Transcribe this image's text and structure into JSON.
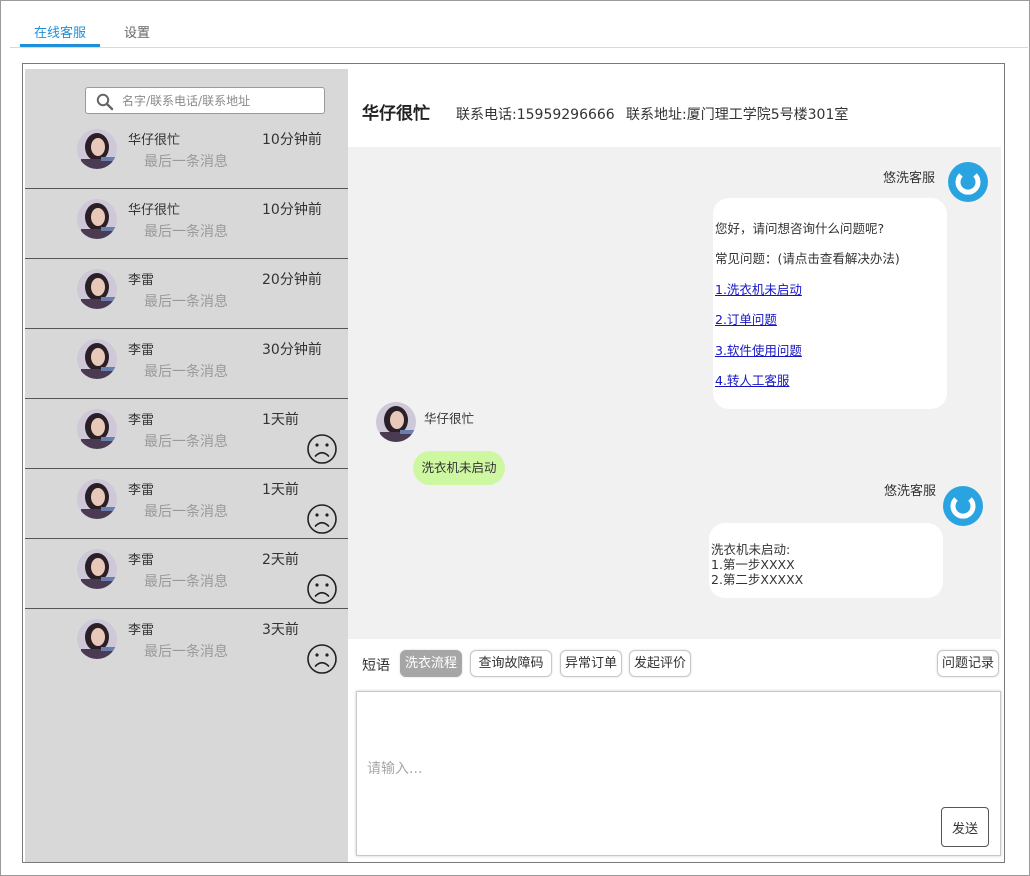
{
  "tabs": [
    {
      "label": "在线客服",
      "active": true
    },
    {
      "label": "设置",
      "active": false
    }
  ],
  "search": {
    "placeholder": "名字/联系电话/联系地址"
  },
  "contacts": [
    {
      "name": "华仔很忙",
      "time": "10分钟前",
      "last_msg": "最后一条消息",
      "sad_icon": false
    },
    {
      "name": "华仔很忙",
      "time": "10分钟前",
      "last_msg": "最后一条消息",
      "sad_icon": false
    },
    {
      "name": "李雷",
      "time": "20分钟前",
      "last_msg": "最后一条消息",
      "sad_icon": false
    },
    {
      "name": "李雷",
      "time": "30分钟前",
      "last_msg": "最后一条消息",
      "sad_icon": false
    },
    {
      "name": "李雷",
      "time": "1天前",
      "last_msg": "最后一条消息",
      "sad_icon": true
    },
    {
      "name": "李雷",
      "time": "1天前",
      "last_msg": "最后一条消息",
      "sad_icon": true
    },
    {
      "name": "李雷",
      "time": "2天前",
      "last_msg": "最后一条消息",
      "sad_icon": true
    },
    {
      "name": "李雷",
      "time": "3天前",
      "last_msg": "最后一条消息",
      "sad_icon": true
    }
  ],
  "header": {
    "name": "华仔很忙",
    "phone": "联系电话:15959296666",
    "address": "联系地址:厦门理工学院5号楼301室"
  },
  "messages": {
    "bot_name": "悠洗客服",
    "greeting": "您好，请问想咨询什么问题呢?",
    "faq_title": "常见问题：(请点击查看解决办法)",
    "faq_links": [
      "1.洗衣机未启动",
      "2.订单问题",
      "3.软件使用问题",
      "4.转人工客服"
    ],
    "user_name": "华仔很忙",
    "user_msg": "洗衣机未启动",
    "bot_name_2": "悠洗客服",
    "reply_lines": [
      "洗衣机未启动:",
      "1.第一步XXXX",
      "2.第二步XXXXX"
    ]
  },
  "toolbar": {
    "label": "短语",
    "chips": [
      "洗衣流程",
      "查询故障码",
      "异常订单",
      "发起评价"
    ],
    "history_label": "问题记录"
  },
  "input": {
    "placeholder": "请输入...",
    "send_label": "发送"
  },
  "colors": {
    "accent": "#1e8fd8",
    "bot_avatar": "#2aa4e0",
    "user_bubble": "#cdf7a0",
    "sidebar_bg": "#d8d8d8",
    "chat_bg": "#f1f1f1",
    "link": "#1515c8"
  },
  "icons": {
    "search": "search-icon",
    "sad": "sad-face-icon",
    "bot_avatar": "bot-logo-icon"
  }
}
